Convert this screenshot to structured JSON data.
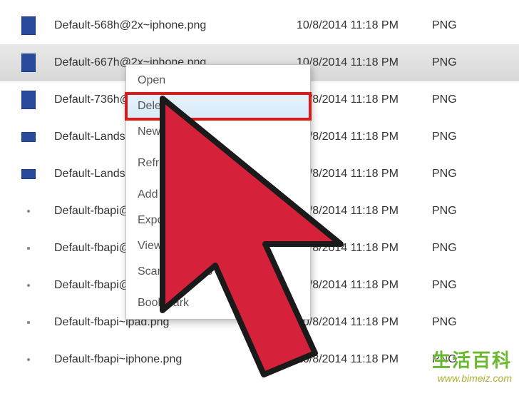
{
  "files": [
    {
      "name": "Default-568h@2x~iphone.png",
      "date": "10/8/2014 11:18 PM",
      "type": "PNG",
      "icon": "full",
      "selected": false
    },
    {
      "name": "Default-667h@2x~iphone.png",
      "date": "10/8/2014 11:18 PM",
      "type": "PNG",
      "icon": "full",
      "selected": true
    },
    {
      "name": "Default-736h@3x~iphone.png",
      "date": "10/8/2014 11:18 PM",
      "type": "PNG",
      "icon": "full",
      "selected": false
    },
    {
      "name": "Default-Landscape-736h@3x~iphone.png",
      "date": "10/8/2014 11:18 PM",
      "type": "PNG",
      "icon": "half",
      "selected": false
    },
    {
      "name": "Default-Landscape@2x~ipad.png",
      "date": "10/8/2014 11:18 PM",
      "type": "PNG",
      "icon": "half",
      "selected": false
    },
    {
      "name": "Default-fbapi@2x~ipad.png",
      "date": "10/8/2014 11:18 PM",
      "type": "PNG",
      "icon": "tiny",
      "selected": false
    },
    {
      "name": "Default-fbapi@2x~iphone.png",
      "date": "10/8/2014 11:18 PM",
      "type": "PNG",
      "icon": "tiny",
      "selected": false
    },
    {
      "name": "Default-fbapi@2x~iphone.png",
      "date": "10/8/2014 11:18 PM",
      "type": "PNG",
      "icon": "tiny",
      "selected": false
    },
    {
      "name": "Default-fbapi~ipad.png",
      "date": "10/8/2014 11:18 PM",
      "type": "PNG",
      "icon": "tiny",
      "selected": false
    },
    {
      "name": "Default-fbapi~iphone.png",
      "date": "10/8/2014 11:18 PM",
      "type": "PNG",
      "icon": "tiny",
      "selected": false
    }
  ],
  "context_menu": {
    "items": [
      {
        "label": "Open",
        "highlighted": false
      },
      {
        "label": "Delete",
        "highlighted": true
      },
      {
        "label": "New Folder",
        "highlighted": false
      },
      {
        "label": "Refresh",
        "highlighted": false
      },
      {
        "label": "Add Files...",
        "highlighted": false
      },
      {
        "label": "Export to Finder",
        "highlighted": false
      },
      {
        "label": "View in Explorer",
        "highlighted": false
      },
      {
        "label": "Scan Contents",
        "highlighted": false
      },
      {
        "label": "Bookmark",
        "highlighted": false
      }
    ]
  },
  "watermark": {
    "cn": "生活百科",
    "url": "www.bimeiz.com"
  },
  "colors": {
    "highlight_outline": "#e21818",
    "cursor_fill": "#d5223a",
    "cursor_stroke": "#1a1a1a"
  }
}
